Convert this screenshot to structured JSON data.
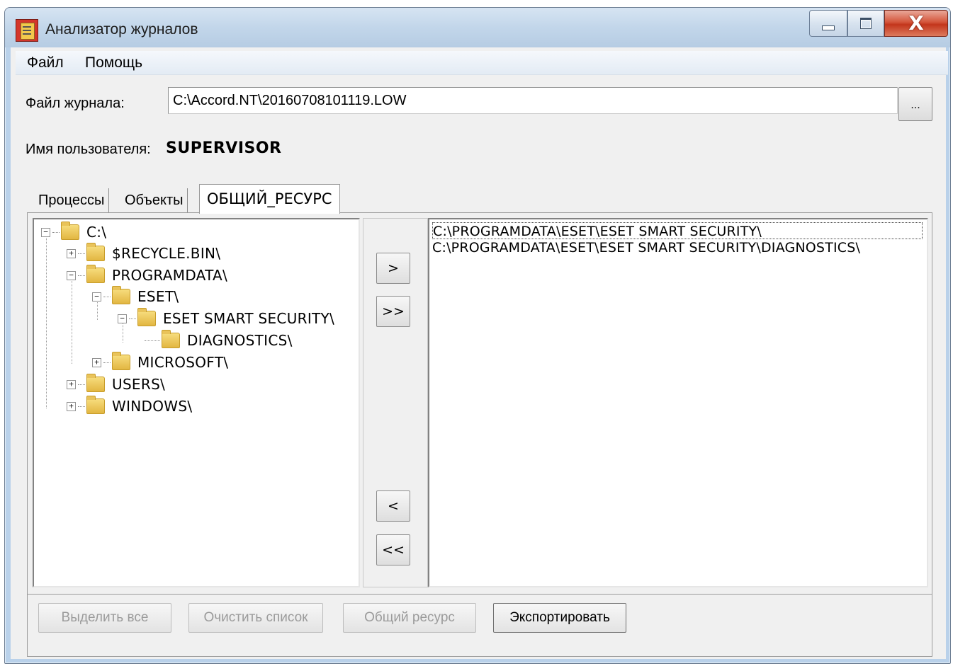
{
  "window": {
    "title": "Анализатор журналов",
    "close_label": "X"
  },
  "menu": {
    "file": "Файл",
    "help": "Помощь"
  },
  "log_file": {
    "label": "Файл журнала:",
    "value": "C:\\Accord.NT\\20160708101119.LOW",
    "browse_label": "..."
  },
  "user": {
    "label": "Имя пользователя:",
    "value": "SUPERVISOR"
  },
  "tabs": [
    {
      "label": "Процессы",
      "active": false
    },
    {
      "label": "Объекты",
      "active": false
    },
    {
      "label": "ОБЩИЙ_РЕСУРС",
      "active": true
    }
  ],
  "tree": [
    {
      "label": "C:\\",
      "toggle": "−"
    },
    {
      "label": "$RECYCLE.BIN\\",
      "toggle": "+"
    },
    {
      "label": "PROGRAMDATA\\",
      "toggle": "−"
    },
    {
      "label": "ESET\\",
      "toggle": "−"
    },
    {
      "label": "ESET SMART SECURITY\\",
      "toggle": "−"
    },
    {
      "label": "DIAGNOSTICS\\",
      "toggle": ""
    },
    {
      "label": "MICROSOFT\\",
      "toggle": "+"
    },
    {
      "label": "USERS\\",
      "toggle": "+"
    },
    {
      "label": "WINDOWS\\",
      "toggle": "+"
    }
  ],
  "transfer": {
    "add": ">",
    "add_all": ">>",
    "remove": "<",
    "remove_all": "<<"
  },
  "selected": [
    "C:\\PROGRAMDATA\\ESET\\ESET SMART SECURITY\\",
    "C:\\PROGRAMDATA\\ESET\\ESET SMART SECURITY\\DIAGNOSTICS\\"
  ],
  "buttons": {
    "select_all": "Выделить все",
    "clear_list": "Очистить список",
    "share": "Общий ресурс",
    "export": "Экспортировать"
  }
}
